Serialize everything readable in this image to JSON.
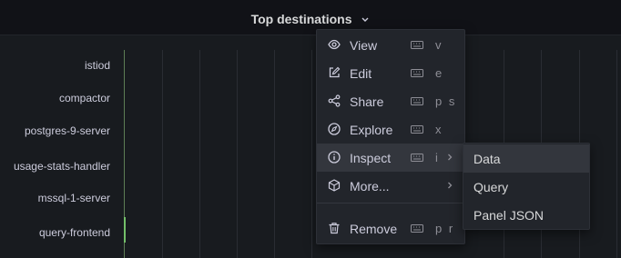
{
  "panel": {
    "title": "Top destinations",
    "labels": [
      "istiod",
      "compactor",
      "postgres-9-server",
      "usage-stats-handler",
      "mssql-1-server",
      "query-frontend"
    ]
  },
  "menu": {
    "items": [
      {
        "label": "View",
        "shortcut": "v",
        "icon": "eye-icon"
      },
      {
        "label": "Edit",
        "shortcut": "e",
        "icon": "edit-icon"
      },
      {
        "label": "Share",
        "shortcut": "p s",
        "icon": "share-icon"
      },
      {
        "label": "Explore",
        "shortcut": "x",
        "icon": "compass-icon"
      },
      {
        "label": "Inspect",
        "shortcut": "i",
        "icon": "info-icon"
      },
      {
        "label": "More...",
        "shortcut": "",
        "icon": "cube-icon"
      },
      {
        "label": "Remove",
        "shortcut": "p r",
        "icon": "trash-icon"
      }
    ]
  },
  "submenu": {
    "items": [
      {
        "label": "Data"
      },
      {
        "label": "Query"
      },
      {
        "label": "Panel JSON"
      }
    ]
  },
  "colors": {
    "bar": "#73bf69",
    "menu_bg": "#22252b",
    "active_bg": "#33363d"
  }
}
